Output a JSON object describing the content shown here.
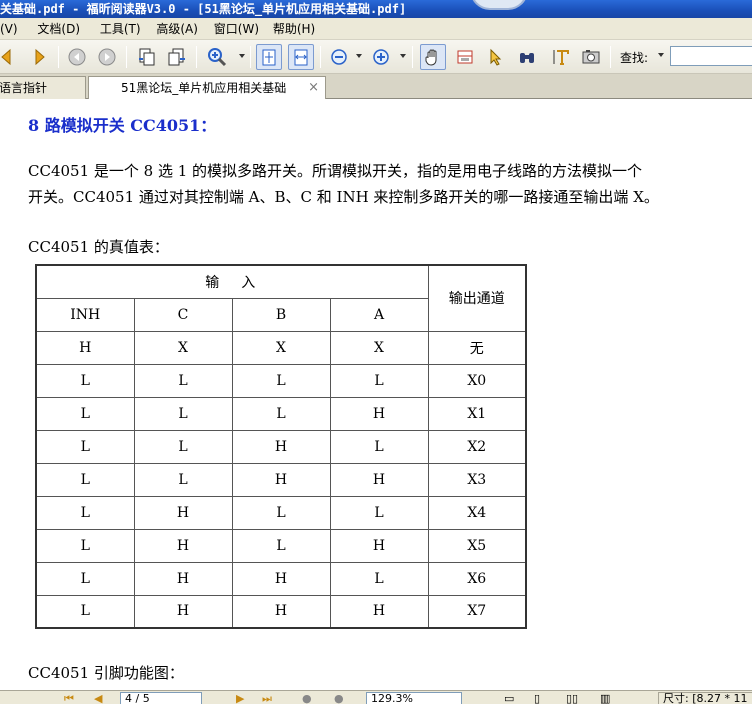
{
  "window": {
    "title": "关基础.pdf - 福昕阅读器V3.0 - [51黑论坛_单片机应用相关基础.pdf]"
  },
  "menu": [
    "(V)",
    "文档(D)",
    "工具(T)",
    "高级(A)",
    "窗口(W)",
    "帮助(H)"
  ],
  "toolbar": {
    "search_label": "查找:",
    "search_value": "",
    "icons": [
      "prev-arrow-icon",
      "next-arrow-icon",
      "back-icon",
      "forward-icon",
      "copy-page-icon",
      "paste-page-icon",
      "zoom-in-icon",
      "fit-page-icon",
      "fit-width-icon",
      "zoom-out-minus-icon",
      "zoom-in-plus-icon",
      "hand-tool-icon",
      "snapshot-select-icon",
      "select-arrow-icon",
      "binoculars-icon",
      "text-tool-icon",
      "camera-icon"
    ]
  },
  "tabs": [
    {
      "label": "语言指针",
      "active": false
    },
    {
      "label": "51黑论坛_单片机应用相关基础",
      "active": true,
      "close": "×"
    }
  ],
  "document": {
    "heading": "8 路模拟开关 CC4051：",
    "para1_line1": "CC4051 是一个 8 选 1 的模拟多路开关。所谓模拟开关，指的是用电子线路的方法模拟一个",
    "para1_line2": "开关。CC4051 通过对其控制端 A、B、C 和 INH 来控制多路开关的哪一路接通至输出端 X。",
    "truth_caption": "CC4051 的真值表：",
    "table": {
      "input_header": "输　入",
      "output_header": "输出通道",
      "columns": [
        "INH",
        "C",
        "B",
        "A"
      ],
      "rows": [
        [
          "H",
          "X",
          "X",
          "X",
          "无"
        ],
        [
          "L",
          "L",
          "L",
          "L",
          "X0"
        ],
        [
          "L",
          "L",
          "L",
          "H",
          "X1"
        ],
        [
          "L",
          "L",
          "H",
          "L",
          "X2"
        ],
        [
          "L",
          "L",
          "H",
          "H",
          "X3"
        ],
        [
          "L",
          "H",
          "L",
          "L",
          "X4"
        ],
        [
          "L",
          "H",
          "L",
          "H",
          "X5"
        ],
        [
          "L",
          "H",
          "H",
          "L",
          "X6"
        ],
        [
          "L",
          "H",
          "H",
          "H",
          "X7"
        ]
      ]
    },
    "pin_caption": "CC4051 引脚功能图："
  },
  "status": {
    "page": "4 / 5",
    "zoom": "129.3%",
    "size": "尺寸: [8.27 * 11"
  }
}
